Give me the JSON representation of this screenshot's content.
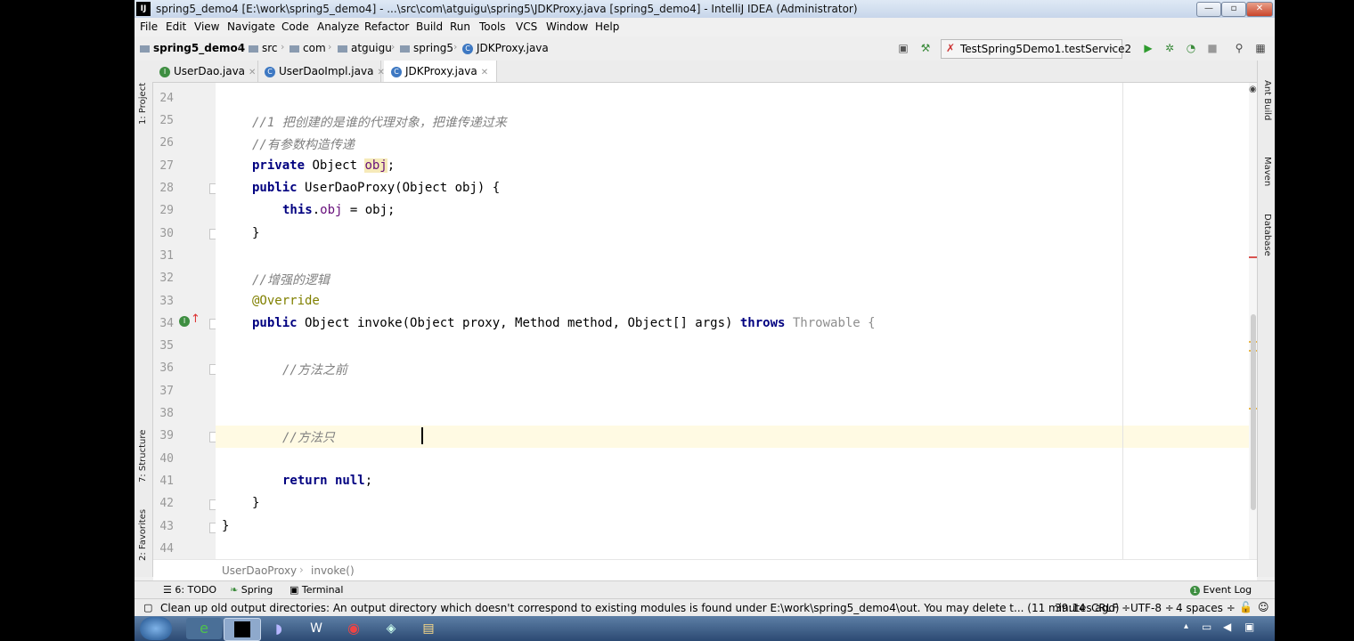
{
  "window": {
    "title": "spring5_demo4 [E:\\work\\spring5_demo4] - ...\\src\\com\\atguigu\\spring5\\JDKProxy.java [spring5_demo4] - IntelliJ IDEA (Administrator)",
    "logo": "IJ",
    "minimize": "—",
    "maximize": "▫",
    "close": "✕"
  },
  "menu": [
    "File",
    "Edit",
    "View",
    "Navigate",
    "Code",
    "Analyze",
    "Refactor",
    "Build",
    "Run",
    "Tools",
    "VCS",
    "Window",
    "Help"
  ],
  "breadcrumbs": {
    "project": "spring5_demo4",
    "items": [
      "src",
      "com",
      "atguigu",
      "spring5",
      "JDKProxy.java"
    ]
  },
  "run_config": "TestSpring5Demo1.testService2",
  "tabs": [
    {
      "label": "UserDao.java",
      "icon_letter": "I",
      "icon_color": "#3e8e41",
      "active": false
    },
    {
      "label": "UserDaoImpl.java",
      "icon_letter": "C",
      "icon_color": "#3d78c2",
      "active": false
    },
    {
      "label": "JDKProxy.java",
      "icon_letter": "C",
      "icon_color": "#3d78c2",
      "active": true
    }
  ],
  "left_tool_windows": [
    "1: Project",
    "7: Structure",
    "2: Favorites"
  ],
  "right_tool_windows": [
    "Ant Build",
    "Maven",
    "Database"
  ],
  "line_numbers": [
    "24",
    "25",
    "26",
    "27",
    "28",
    "29",
    "30",
    "31",
    "32",
    "33",
    "34",
    "35",
    "36",
    "37",
    "38",
    "39",
    "40",
    "41",
    "42",
    "43",
    "44"
  ],
  "code": {
    "l25": "//1 把创建的是谁的代理对象，把谁传递过来",
    "l26": "//有参数构造传递",
    "l27_kw": "private",
    "l27_type": " Object ",
    "l27_field": "obj",
    "l27_end": ";",
    "l28_kw": "public",
    "l28_rest": " UserDaoProxy(Object obj) {",
    "l29_kw": "this",
    "l29_dot": ".",
    "l29_field": "obj",
    "l29_rest": " = obj;",
    "l30": "}",
    "l32": "//增强的逻辑",
    "l33": "@Override",
    "l34_kw": "public",
    "l34_rest": " Object invoke(Object proxy, Method method, Object[] args) ",
    "l34_throws": "throws",
    "l34_throwable": " Throwable",
    "l34_brace": " {",
    "l36": "//方法之前",
    "l39": "//方法只",
    "l41_kw": "return",
    "l41_null": " null",
    "l41_end": ";",
    "l42": "}",
    "l43": "}"
  },
  "code_breadcrumb": [
    "UserDaoProxy",
    "invoke()"
  ],
  "tool_windows": [
    "6: TODO",
    "Spring",
    "Terminal"
  ],
  "event_log": "Event Log",
  "status": {
    "message": "Clean up old output directories: An output directory which doesn't correspond to existing modules is found under E:\\work\\spring5_demo4\\out. You may delete t... (11 minutes ago)",
    "position": "39:14",
    "line_sep": "CRLF ÷",
    "encoding": "UTF-8 ÷",
    "indent": "4 spaces ÷"
  }
}
